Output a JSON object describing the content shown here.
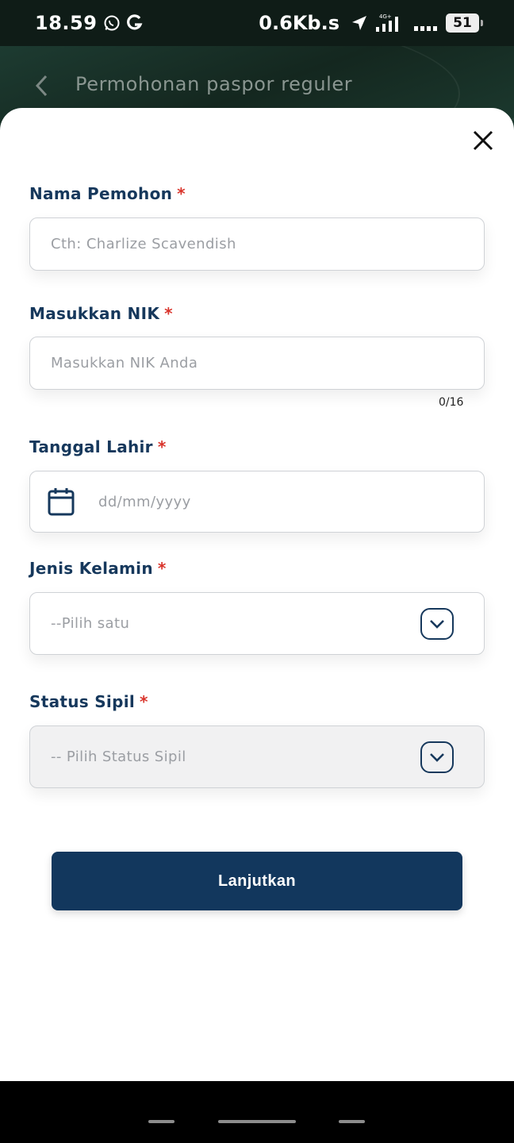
{
  "status_bar": {
    "time": "18.59",
    "network_speed": "0.6Kb.s",
    "network_type": "4G+",
    "battery": "51",
    "icons": [
      "whatsapp-icon",
      "g-icon",
      "location-arrow-icon",
      "signal-icon",
      "more-dots-icon",
      "battery-icon"
    ]
  },
  "app_bar": {
    "title": "Permohonan paspor reguler",
    "back_icon": "chevron-left-icon"
  },
  "form": {
    "close_icon": "close-icon",
    "required_marker": "*",
    "fields": {
      "nama": {
        "label": "Nama Pemohon",
        "placeholder": "Cth: Charlize Scavendish",
        "value": ""
      },
      "nik": {
        "label": "Masukkan NIK",
        "placeholder": "Masukkan NIK Anda",
        "value": "",
        "counter": "0/16"
      },
      "tanggal_lahir": {
        "label": "Tanggal Lahir",
        "placeholder": "dd/mm/yyyy",
        "value": ""
      },
      "jenis_kelamin": {
        "label": "Jenis Kelamin",
        "placeholder": "--Pilih satu",
        "value": ""
      },
      "status_sipil": {
        "label": "Status Sipil",
        "placeholder": "-- Pilih Status Sipil",
        "value": ""
      }
    },
    "submit_label": "Lanjutkan"
  },
  "colors": {
    "primary": "#12375d",
    "label": "#16385c",
    "required": "#d9342b",
    "placeholder": "#9b9ea3",
    "app_bar": "#14271f"
  }
}
